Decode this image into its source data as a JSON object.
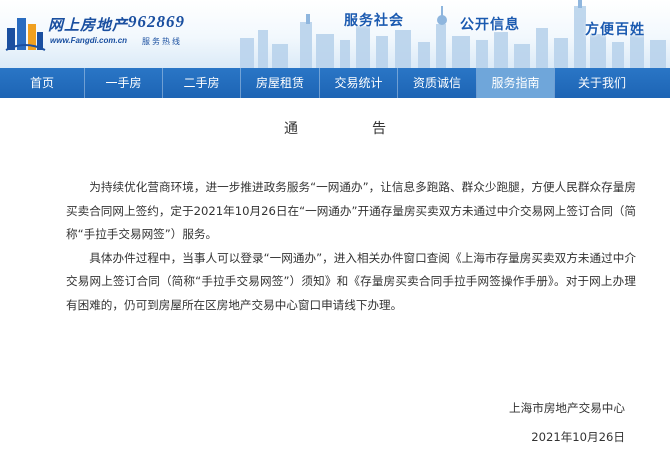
{
  "header": {
    "site_name": "网上房地产",
    "site_url": "www.Fangdi.com.cn",
    "hotline_number": "962869",
    "hotline_label": "服务热线",
    "slogans": [
      "服务社会",
      "公开信息",
      "方便百姓"
    ],
    "brand_color": "#1d64b4"
  },
  "nav": {
    "items": [
      {
        "label": "首页",
        "active": false
      },
      {
        "label": "一手房",
        "active": false
      },
      {
        "label": "二手房",
        "active": false
      },
      {
        "label": "房屋租赁",
        "active": false
      },
      {
        "label": "交易统计",
        "active": false
      },
      {
        "label": "资质诚信",
        "active": false
      },
      {
        "label": "服务指南",
        "active": true
      },
      {
        "label": "关于我们",
        "active": false
      }
    ]
  },
  "notice": {
    "title_chars": [
      "通",
      "告"
    ],
    "paragraphs": [
      "为持续优化营商环境，进一步推进政务服务“一网通办”，让信息多跑路、群众少跑腿，方便人民群众存量房买卖合同网上签约，定于2021年10月26日在“一网通办”开通存量房买卖双方未通过中介交易网上签订合同（简称“手拉手交易网签”）服务。",
      "具体办件过程中，当事人可以登录“一网通办”，进入相关办件窗口查阅《上海市存量房买卖双方未通过中介交易网上签订合同（简称“手拉手交易网签”）须知》和《存量房买卖合同手拉手网签操作手册》。对于网上办理有困难的，仍可到房屋所在区房地产交易中心窗口申请线下办理。"
    ],
    "signature": "上海市房地产交易中心",
    "date": "2021年10月26日"
  }
}
